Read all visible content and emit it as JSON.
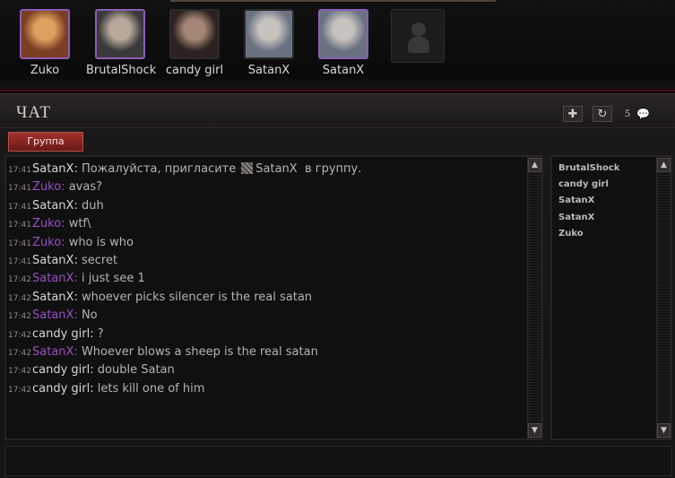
{
  "party": {
    "members": [
      {
        "name": "Zuko",
        "highlighted": true,
        "avatar_colors": [
          "#7a3e22",
          "#e0a060"
        ]
      },
      {
        "name": "BrutalShock",
        "highlighted": true,
        "avatar_colors": [
          "#3a3a3a",
          "#b9a99a"
        ]
      },
      {
        "name": "candy girl",
        "highlighted": false,
        "avatar_colors": [
          "#2e2220",
          "#a58677"
        ]
      },
      {
        "name": "SatanX",
        "highlighted": false,
        "avatar_colors": [
          "#6a7282",
          "#c6c2be"
        ]
      },
      {
        "name": "SatanX",
        "highlighted": true,
        "avatar_colors": [
          "#6a7282",
          "#c6c2be"
        ]
      }
    ],
    "empty_slot_icon": "person-silhouette-icon"
  },
  "chat": {
    "title": "ЧАТ",
    "add_icon": "plus-icon",
    "refresh_icon": "refresh-icon",
    "member_count": "5",
    "count_icon": "speech-bubble-icon",
    "tabs": [
      {
        "label": "Группа",
        "active": true
      }
    ],
    "messages": [
      {
        "time": "17:41",
        "author": "SatanX",
        "author_color": "white",
        "text": "Пожалуйста, пригласите",
        "invite_name": "SatanX",
        "text_after": "в группу."
      },
      {
        "time": "17:41",
        "author": "Zuko",
        "author_color": "purple",
        "text": "avas?"
      },
      {
        "time": "17:41",
        "author": "SatanX",
        "author_color": "white",
        "text": "duh"
      },
      {
        "time": "17:41",
        "author": "Zuko",
        "author_color": "purple",
        "text": "wtf\\"
      },
      {
        "time": "17:41",
        "author": "Zuko",
        "author_color": "purple",
        "text": "who is who"
      },
      {
        "time": "17:41",
        "author": "SatanX",
        "author_color": "white",
        "text": "secret"
      },
      {
        "time": "17:42",
        "author": "SatanX",
        "author_color": "purple",
        "text": "i just see 1"
      },
      {
        "time": "17:42",
        "author": "SatanX",
        "author_color": "white",
        "text": "whoever picks silencer is the real satan"
      },
      {
        "time": "17:42",
        "author": "SatanX",
        "author_color": "purple",
        "text": "No"
      },
      {
        "time": "17:42",
        "author": "candy girl",
        "author_color": "white",
        "text": "?"
      },
      {
        "time": "17:42",
        "author": "SatanX",
        "author_color": "purple",
        "text": "Whoever blows a sheep is the real satan"
      },
      {
        "time": "17:42",
        "author": "candy girl",
        "author_color": "white",
        "text": "double Satan"
      },
      {
        "time": "17:42",
        "author": "candy girl",
        "author_color": "white",
        "text": "lets kill one of him"
      }
    ],
    "member_list": [
      "BrutalShock",
      "candy girl",
      "SatanX",
      "SatanX",
      "Zuko"
    ],
    "input": {
      "value": "",
      "placeholder": ""
    },
    "scroll_up_icon": "triangle-up-icon",
    "scroll_down_icon": "triangle-down-icon"
  },
  "colors": {
    "accent_red": "#a1322c",
    "purple_name": "#9a4fc4",
    "frame_highlight": "#8e5cb8"
  }
}
